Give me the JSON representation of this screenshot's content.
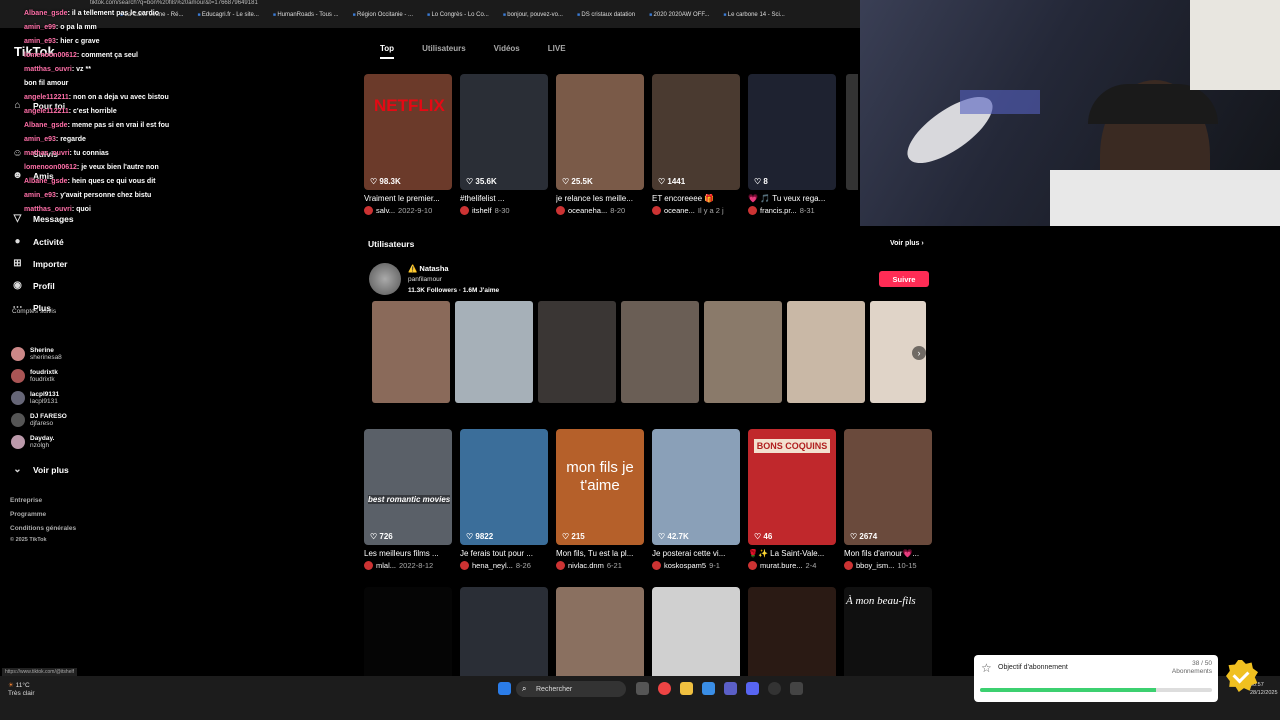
{
  "browser": {
    "url": "tiktok.com/search?q=bon%20fils%20amour&t=1766879649181",
    "bookmarks": [
      "La Carte Jeune - Ré...",
      "Educagri.fr - Le site...",
      "HumanRoads - Tous ...",
      "Région Occitanie - ...",
      "Lo Congrès - Lo Co...",
      "bonjour, pouvez-vo...",
      "DS cristaux datation",
      "2020 2020AW OFF...",
      "Le carbone 14 - Sci..."
    ],
    "status_url": "https://www.tiktok.com/@itshelf"
  },
  "chat": [
    {
      "user": "Albane_gsde",
      "msg": ": il a tellement pas le cardio"
    },
    {
      "user": "amin_e99",
      "msg": ": o pa la mm"
    },
    {
      "user": "amin_e93",
      "msg": ": hier c grave"
    },
    {
      "user": "lomenoon00612",
      "msg": ": comment ça seul"
    },
    {
      "user": "matthas_ouvri",
      "msg": ": vz **"
    },
    {
      "user": "",
      "msg": "bon fil amour"
    },
    {
      "user": "angele112211",
      "msg": ": non on a deja vu avec bistou"
    },
    {
      "user": "angele112211",
      "msg": ": c'est horrible"
    },
    {
      "user": "Albane_gsde",
      "msg": ": meme pas si en vrai il est fou"
    },
    {
      "user": "amin_e93",
      "msg": ": regarde"
    },
    {
      "user": "mathas_ouvri",
      "msg": ": tu connias"
    },
    {
      "user": "lomenoon00612",
      "msg": ": je veux bien l'autre non"
    },
    {
      "user": "Albane_gsde",
      "msg": ": hein ques ce qui vous dit"
    },
    {
      "user": "amin_e93",
      "msg": ": y'avait personne chez bistu"
    },
    {
      "user": "matthas_ouvri",
      "msg": ": quoi"
    }
  ],
  "sidebar": {
    "logo": "TikTok",
    "nav": [
      "Pour toi",
      "Suivis",
      "Amis",
      "Messages",
      "Activité",
      "Importer",
      "Profil",
      "Plus"
    ],
    "follows_title": "Comptes suivis",
    "accounts": [
      {
        "name": "Sherine",
        "handle": "sherinesa8"
      },
      {
        "name": "foudrixtk",
        "handle": "foudrixtk"
      },
      {
        "name": "lacpl9131",
        "handle": "lacpl9131"
      },
      {
        "name": "DJ FARESO",
        "handle": "djfareso"
      },
      {
        "name": "Dayday.",
        "handle": "nzolgh"
      }
    ],
    "see_more": "Voir plus",
    "footer": [
      "Entreprise",
      "Programme",
      "Conditions générales",
      "© 2025 TikTok"
    ]
  },
  "tabs": [
    "Top",
    "Utilisateurs",
    "Vidéos",
    "LIVE"
  ],
  "top_row": [
    {
      "likes": "98.3K",
      "caption": "Vraiment le premier...",
      "user": "salv...",
      "date": "2022-9-10",
      "bg": "#6b3a2a"
    },
    {
      "likes": "35.6K",
      "caption": "#thelifelist ...",
      "user": "itshelf",
      "date": "8-30",
      "bg": "#2a2e36"
    },
    {
      "likes": "25.5K",
      "caption": "je relance les meille...",
      "user": "oceaneha...",
      "date": "8-20",
      "bg": "#7a5a48"
    },
    {
      "likes": "1441",
      "caption": "ET encoreeee 🎁",
      "user": "oceane...",
      "date": "Il y a 2 j",
      "bg": "#4a3a30"
    },
    {
      "likes": "8",
      "caption": "💗 🎵 Tu veux rega...",
      "user": "francis.pr...",
      "date": "8-31",
      "bg": "#1e2230"
    }
  ],
  "users": {
    "title": "Utilisateurs",
    "see_all": "Voir plus ›",
    "name": "⚠️ Natasha",
    "handle": "panfilamour",
    "stats": "11.3K Followers · 1.6M J'aime",
    "follow": "Suivre"
  },
  "grid_row": [
    {
      "likes": "726",
      "caption": "Les meilleurs films ...",
      "user": "mlal...",
      "date": "2022-8-12",
      "bg": "#5a6068"
    },
    {
      "likes": "9822",
      "caption": "Je ferais tout pour ...",
      "user": "hena_neyl...",
      "date": "8-26",
      "bg": "#3b6e9a"
    },
    {
      "likes": "215",
      "caption": "Mon fils, Tu est la pl...",
      "user": "nivlac.dnm",
      "date": "6-21",
      "bg": "#b5602a"
    },
    {
      "likes": "42.7K",
      "caption": "Je posterai cette vi...",
      "user": "koskospam5",
      "date": "9-1",
      "bg": "#8aa0b8"
    },
    {
      "likes": "46",
      "caption": "🌹✨ La Saint-Vale...",
      "user": "murat.bure...",
      "date": "2-4",
      "bg": "#c0282c"
    },
    {
      "likes": "2674",
      "caption": "Mon fils d'amour💗...",
      "user": "bboy_ism...",
      "date": "10-15",
      "bg": "#6a4a3c"
    }
  ],
  "thumb_texts": {
    "netflix": "NETFLIX",
    "mon_fils": "mon fils je t'aime",
    "best_movies": "best romantic movies",
    "bons": "BONS COQUINS",
    "mon_beau_fils": "À mon beau-fils"
  },
  "taskbar": {
    "weather_temp": "11°C",
    "weather_desc": "Très clair",
    "search": "Rechercher",
    "time": "00:57",
    "date": "28/12/2025"
  },
  "goal": {
    "title": "Objectif d'abonnement",
    "count": "38 / 50",
    "label": "Abonnements",
    "progress": 0.76
  },
  "colors": {
    "accent": "#fe2c55",
    "goal": "#3cd070"
  }
}
